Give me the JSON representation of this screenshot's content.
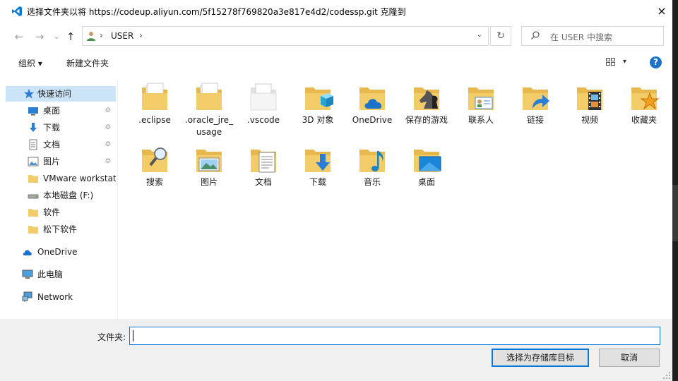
{
  "window": {
    "title": "选择文件夹以将 https://codeup.aliyun.com/5f15278f769820a3e817e4d2/codessp.git 克隆到",
    "close_icon": "×"
  },
  "nav": {
    "back_icon": "←",
    "forward_icon": "→",
    "recent_icon": "⌄",
    "up_icon": "↑",
    "breadcrumb_separator": "›",
    "breadcrumb": "USER",
    "address_dropdown_icon": "⌄",
    "refresh_icon": "↻",
    "search_placeholder": "在 USER 中搜索"
  },
  "toolbar": {
    "organize": "组织 ▾",
    "new_folder": "新建文件夹",
    "view_dropdown_icon": "▾",
    "help": "?"
  },
  "sidebar": {
    "items": [
      {
        "label": "快速访问",
        "icon": "star-icon"
      },
      {
        "label": "桌面",
        "icon": "desktop-icon",
        "pinned": true
      },
      {
        "label": "下载",
        "icon": "download-icon",
        "pinned": true
      },
      {
        "label": "文档",
        "icon": "document-icon",
        "pinned": true
      },
      {
        "label": "图片",
        "icon": "pictures-icon",
        "pinned": true
      },
      {
        "label": "VMware workstat",
        "icon": "folder-icon"
      },
      {
        "label": "本地磁盘 (F:)",
        "icon": "drive-icon"
      },
      {
        "label": "软件",
        "icon": "folder-icon"
      },
      {
        "label": "松下软件",
        "icon": "folder-icon"
      },
      {
        "label": "OneDrive",
        "icon": "cloud-icon"
      },
      {
        "label": "此电脑",
        "icon": "computer-icon"
      },
      {
        "label": "Network",
        "icon": "network-icon"
      }
    ],
    "pin_glyph": "📌"
  },
  "files": [
    {
      "name": ".eclipse",
      "icon": "folder-docs-icon"
    },
    {
      "name": ".oracle_jre_usage",
      "icon": "folder-docs-icon"
    },
    {
      "name": ".vscode",
      "icon": "folder-white-icon"
    },
    {
      "name": "3D 对象",
      "icon": "folder-3d-icon"
    },
    {
      "name": "OneDrive",
      "icon": "folder-onedrive-icon"
    },
    {
      "name": "保存的游戏",
      "icon": "folder-games-icon"
    },
    {
      "name": "联系人",
      "icon": "folder-contacts-icon"
    },
    {
      "name": "链接",
      "icon": "folder-links-icon"
    },
    {
      "name": "视频",
      "icon": "folder-video-icon"
    },
    {
      "name": "收藏夹",
      "icon": "folder-favorites-icon"
    },
    {
      "name": "搜索",
      "icon": "folder-search-icon"
    },
    {
      "name": "图片",
      "icon": "folder-pictures-icon"
    },
    {
      "name": "文档",
      "icon": "folder-documents-icon"
    },
    {
      "name": "下载",
      "icon": "folder-downloads-icon"
    },
    {
      "name": "音乐",
      "icon": "folder-music-icon"
    },
    {
      "name": "桌面",
      "icon": "folder-desktop-icon"
    }
  ],
  "bottom": {
    "folder_label": "文件夹:",
    "folder_value": "",
    "ok_button": "选择为存储库目标",
    "cancel_button": "取消"
  },
  "colors": {
    "accent": "#0078d7",
    "selection": "#cce4f7",
    "folder": "#f3cc6a"
  }
}
